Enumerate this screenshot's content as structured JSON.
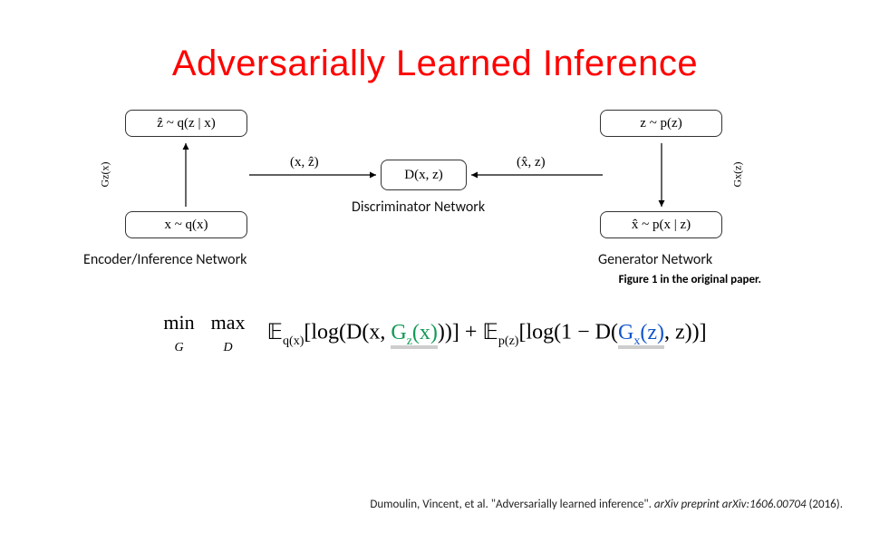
{
  "title": "Adversarially Learned Inference",
  "diagram": {
    "top_left": "ẑ ~ q(z | x)",
    "bottom_left": "x ~ q(x)",
    "top_right": "z ~ p(z)",
    "bottom_right": "x̂ ~ p(x | z)",
    "center": "D(x, z)",
    "left_side_label": "Gz(x)",
    "right_side_label": "Gx(z)",
    "edge_left": "(x, ẑ)",
    "edge_right": "(x̂, z)",
    "discriminator_label": "Discriminator Network",
    "encoder_label": "Encoder/Inference Network",
    "generator_label": "Generator Network"
  },
  "caption": "Figure 1 in the original paper.",
  "formula": {
    "min": "min",
    "minvar": "G",
    "max": "max",
    "maxvar": "D",
    "E1sub": "q(x)",
    "logD": "[log(D(x, ",
    "gz": "G",
    "gzsub": "z",
    "gzarg": "(x)",
    "close1": "))] + ",
    "E2sub": "p(z)",
    "log1m": "[log(1 − D(",
    "gx": "G",
    "gxsub": "x",
    "gxarg": "(z)",
    "close2": ", z))]"
  },
  "citation": {
    "authors": "Dumoulin, Vincent, et al. \"Adversarially learned inference\". ",
    "venue": "arXiv preprint arXiv:1606.00704",
    "year": " (2016)."
  }
}
